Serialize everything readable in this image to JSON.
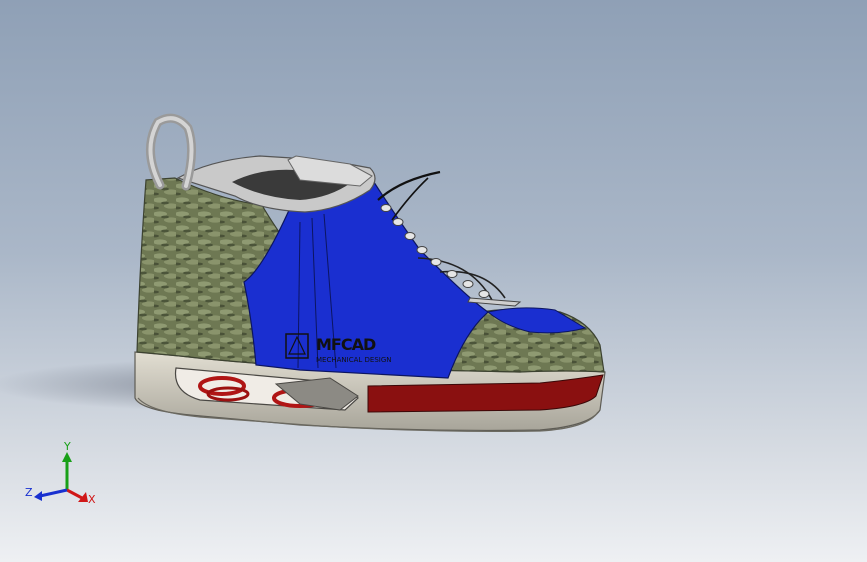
{
  "viewport": {
    "background_top": "#8fa0b6",
    "background_bottom": "#eef0f3"
  },
  "model": {
    "logo_text": "MFCAD",
    "logo_subtext": "MECHANICAL DESIGN",
    "colors": {
      "blue_panel": "#1a2fd0",
      "tweed": "#6f7a55",
      "sole": "#d3d0c4",
      "red_trim": "#8a1010",
      "collar": "#c9c9c9"
    }
  },
  "triad": {
    "x_label": "X",
    "y_label": "Y",
    "z_label": "Z",
    "x_color": "#d01818",
    "y_color": "#18a018",
    "z_color": "#1830d0"
  }
}
